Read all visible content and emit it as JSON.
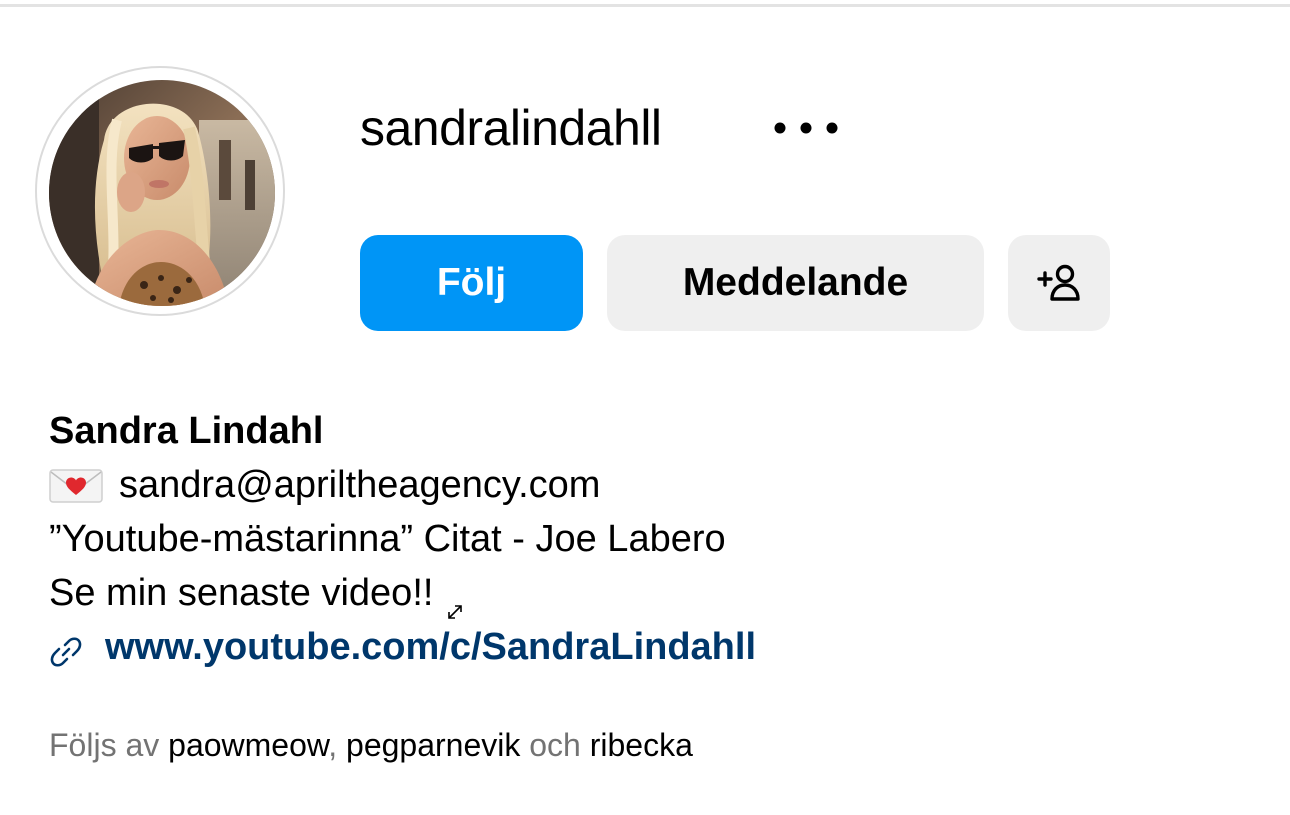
{
  "profile": {
    "username": "sandralindahll",
    "display_name": "Sandra Lindahl",
    "avatar_alt": "Profilbild för sandralindahll"
  },
  "actions": {
    "follow_label": "Följ",
    "message_label": "Meddelande",
    "more_icon": "more-horizontal-icon",
    "suggest_icon": "add-person-icon"
  },
  "bio": {
    "email": "sandra@apriltheagency.com",
    "quote": "”Youtube-mästarinna” Citat - Joe Labero",
    "video": "Se min senaste video!!",
    "link": "www.youtube.com/c/SandraLindahll"
  },
  "followed_by": {
    "prefix": "Följs av",
    "accounts": [
      "paowmeow",
      "pegparnevik",
      "ribecka"
    ],
    "separator": ",",
    "conjunction": "och"
  },
  "colors": {
    "follow_button": "#0095f6",
    "secondary_button": "#efefef",
    "link": "#00376b",
    "muted_text": "#737373"
  }
}
